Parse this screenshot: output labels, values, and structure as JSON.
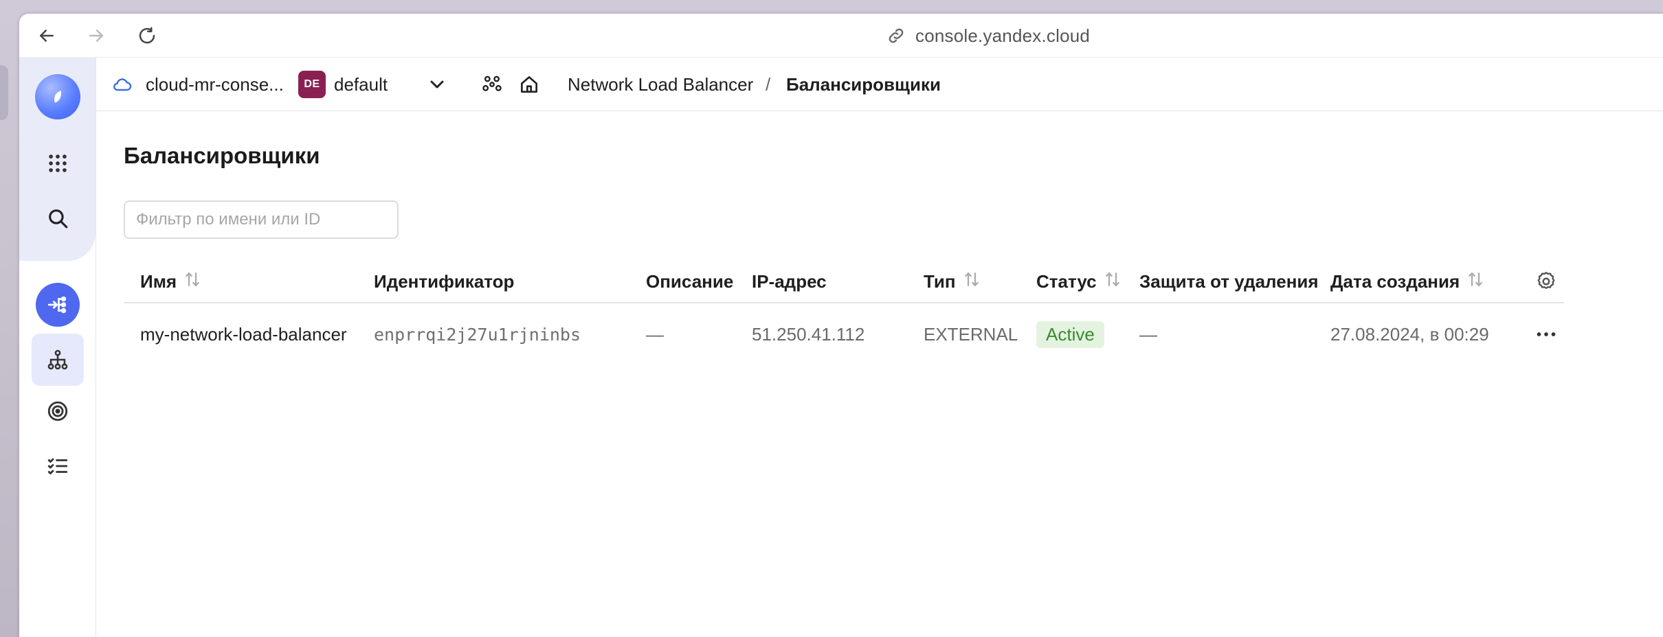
{
  "browser": {
    "url": "console.yandex.cloud"
  },
  "header": {
    "cloud_name": "cloud-mr-conse...",
    "folder_badge": "DE",
    "folder_name": "default",
    "breadcrumb": {
      "service": "Network Load Balancer",
      "separator": "/",
      "current": "Балансировщики"
    }
  },
  "page": {
    "title": "Балансировщики",
    "filter_placeholder": "Фильтр по имени или ID"
  },
  "table": {
    "columns": [
      {
        "label": "Имя",
        "sortable": true
      },
      {
        "label": "Идентификатор",
        "sortable": false
      },
      {
        "label": "Описание",
        "sortable": false
      },
      {
        "label": "IP-адрес",
        "sortable": false
      },
      {
        "label": "Тип",
        "sortable": true
      },
      {
        "label": "Статус",
        "sortable": true
      },
      {
        "label": "Защита от удаления",
        "sortable": false
      },
      {
        "label": "Дата создания",
        "sortable": true
      }
    ],
    "rows": [
      {
        "name": "my-network-load-balancer",
        "id": "enprrqi2j27u1rjninbs",
        "description": "—",
        "ip": "51.250.41.112",
        "type": "EXTERNAL",
        "status": "Active",
        "deletion_protection": "—",
        "created": "27.08.2024, в 00:29"
      }
    ]
  },
  "colors": {
    "accent": "#4e68f0",
    "folder_badge_bg": "#8a2052",
    "status_active_bg": "#e4f3df",
    "status_active_text": "#3a8a2d"
  },
  "icons": {
    "rail": [
      "yandex-cloud-logo-icon",
      "apps-grid-icon",
      "search-icon",
      "load-balancer-service-icon",
      "network-topology-icon",
      "target-icon",
      "checklist-icon"
    ]
  }
}
